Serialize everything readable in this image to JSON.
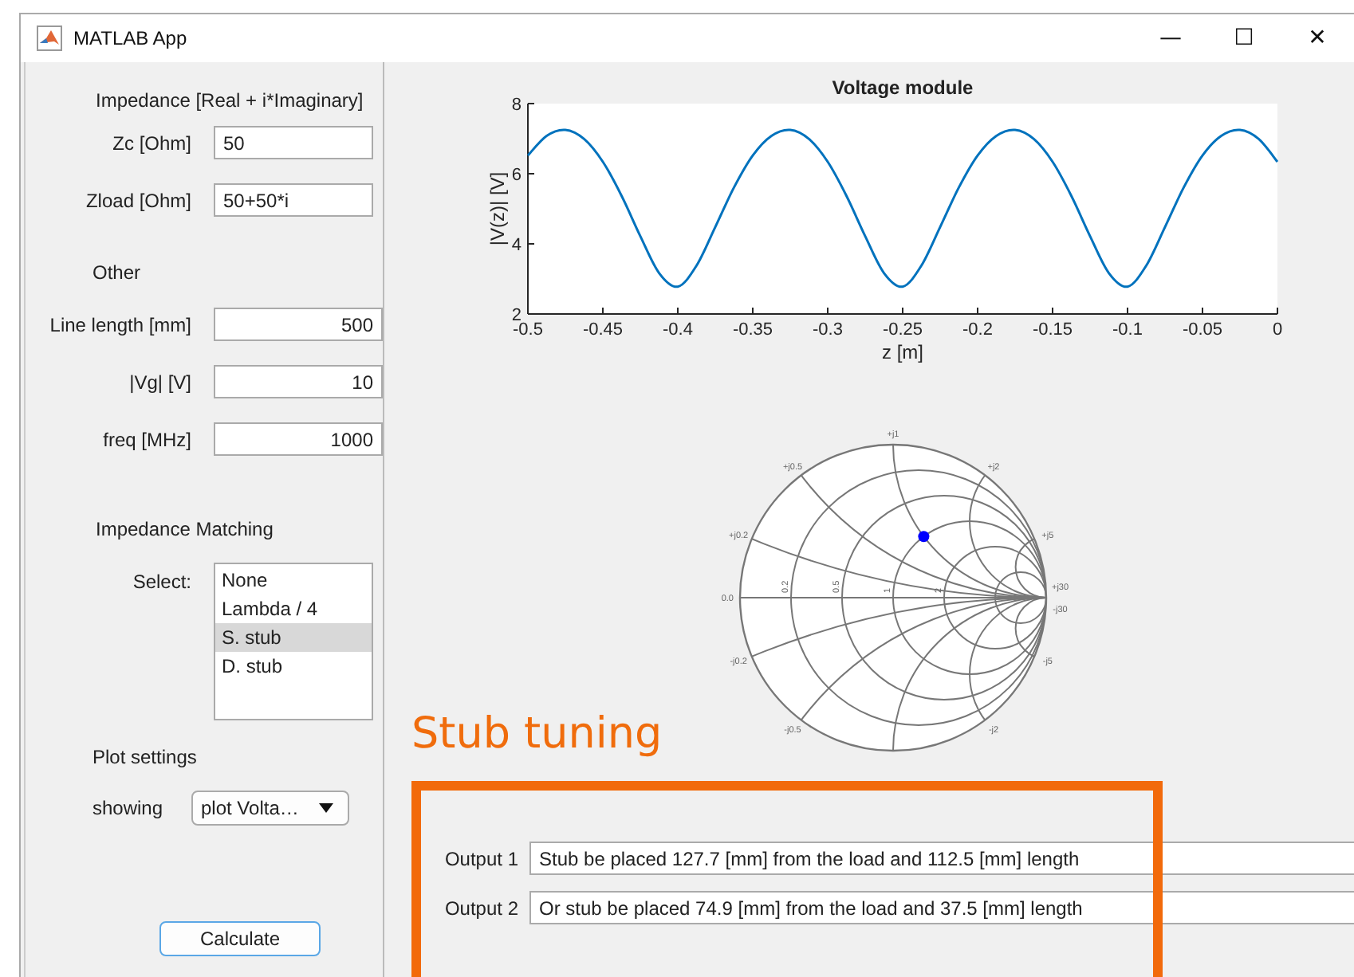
{
  "window": {
    "title": "MATLAB App",
    "controls": [
      "—",
      "☐",
      "✕"
    ]
  },
  "impedance": {
    "heading": "Impedance [Real + i*Imaginary]",
    "fields": [
      {
        "label": "Zc [Ohm]",
        "value": "50"
      },
      {
        "label": "Zload [Ohm]",
        "value": "50+50*i"
      }
    ]
  },
  "other": {
    "heading": "Other",
    "fields": [
      {
        "label": "Line length [mm]",
        "value": "500"
      },
      {
        "label": "|Vg| [V]",
        "value": "10"
      },
      {
        "label": "freq [MHz]",
        "value": "1000"
      }
    ]
  },
  "matching": {
    "heading": "Impedance Matching",
    "label": "Select:",
    "items": [
      {
        "label": "None",
        "selected": false
      },
      {
        "label": "Lambda / 4",
        "selected": false
      },
      {
        "label": "S. stub",
        "selected": true
      },
      {
        "label": "D. stub",
        "selected": false
      }
    ]
  },
  "plot_settings": {
    "heading": "Plot settings",
    "label": "showing",
    "dropdown": "plot Volta…"
  },
  "calculate_button": "Calculate",
  "voltage_plot": {
    "chart_data": {
      "type": "line",
      "title": "Voltage module",
      "xlabel": "z [m]",
      "ylabel": "|V(z)| [V]",
      "x": [
        -0.5,
        -0.4875,
        -0.475,
        -0.4625,
        -0.45,
        -0.4375,
        -0.425,
        -0.4125,
        -0.4,
        -0.3875,
        -0.375,
        -0.3625,
        -0.35,
        -0.3375,
        -0.325,
        -0.3125,
        -0.3,
        -0.2875,
        -0.275,
        -0.2625,
        -0.25,
        -0.2375,
        -0.225,
        -0.2125,
        -0.2,
        -0.1875,
        -0.175,
        -0.1625,
        -0.15,
        -0.1375,
        -0.125,
        -0.1125,
        -0.1,
        -0.0875,
        -0.075,
        -0.0625,
        -0.05,
        -0.0375,
        -0.025,
        -0.0125,
        0
      ],
      "series": [
        {
          "color": "#0072bd",
          "values": [
            6.52,
            7.08,
            7.25,
            6.99,
            6.34,
            5.37,
            4.22,
            3.17,
            2.78,
            3.38,
            4.48,
            5.61,
            6.52,
            7.08,
            7.25,
            6.99,
            6.34,
            5.37,
            4.22,
            3.17,
            2.78,
            3.38,
            4.48,
            5.61,
            6.52,
            7.08,
            7.25,
            6.99,
            6.34,
            5.37,
            4.22,
            3.17,
            2.78,
            3.38,
            4.48,
            5.61,
            6.52,
            7.08,
            7.25,
            6.99,
            6.34
          ]
        }
      ],
      "xlim": [
        -0.5,
        0
      ],
      "ylim": [
        2,
        8
      ],
      "xticks": [
        -0.5,
        -0.45,
        -0.4,
        -0.35,
        -0.3,
        -0.25,
        -0.2,
        -0.15,
        -0.1,
        -0.05,
        0
      ],
      "yticks": [
        2,
        4,
        6,
        8
      ]
    }
  },
  "smith_chart": {
    "reactance_labels": [
      "+j0.2",
      "+j0.5",
      "+j1",
      "+j2",
      "+j5",
      "+j30",
      "-j0.2",
      "-j0.5",
      "-j2",
      "-j5",
      "-j30"
    ],
    "origin_label": "0.0",
    "resistance_labels": [
      "0.2",
      "0.5",
      "1",
      "2"
    ]
  },
  "stub_tuning": {
    "heading": "Stub tuning",
    "outputs": [
      {
        "label": "Output 1",
        "value": "Stub be placed 127.7 [mm] from the load and 112.5 [mm] length"
      },
      {
        "label": "Output 2",
        "value": "Or stub be placed 74.9 [mm] from the load and 37.5 [mm] length"
      }
    ]
  }
}
